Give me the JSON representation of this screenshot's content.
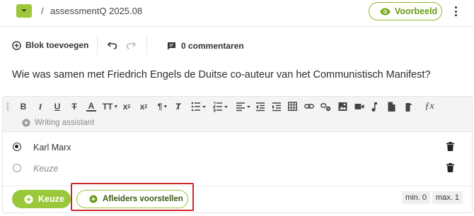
{
  "header": {
    "breadcrumb_separator": "/",
    "breadcrumb_label": "assessmentQ 2025.08",
    "preview_label": "Voorbeeld",
    "accent_color": "#9ac83a"
  },
  "actions": {
    "add_block_label": "Blok toevoegen",
    "comments_label": "0 commentaren"
  },
  "question": {
    "text": "Wie was samen met Friedrich Engels de Duitse co-auteur van het Communistisch Manifest?"
  },
  "toolbar": {
    "buttons": [
      "bold",
      "italic",
      "underline",
      "strikethrough",
      "font-color",
      "text-size",
      "subscript",
      "superscript",
      "paragraph",
      "clear-format",
      "bulleted-list",
      "numbered-list",
      "align",
      "indent",
      "outdent",
      "table",
      "link",
      "unlink",
      "image",
      "video",
      "audio",
      "file",
      "formula"
    ],
    "writing_assistant_label": "Writing assistant"
  },
  "choices": [
    {
      "text": "Karl Marx",
      "selected": true,
      "placeholder": false
    },
    {
      "text": "Keuze",
      "selected": false,
      "placeholder": true
    }
  ],
  "footer": {
    "add_choice_label": "Keuze",
    "suggest_distractors_label": "Afleiders voorstellen",
    "min_label": "min. 0",
    "max_label": "max. 1"
  }
}
